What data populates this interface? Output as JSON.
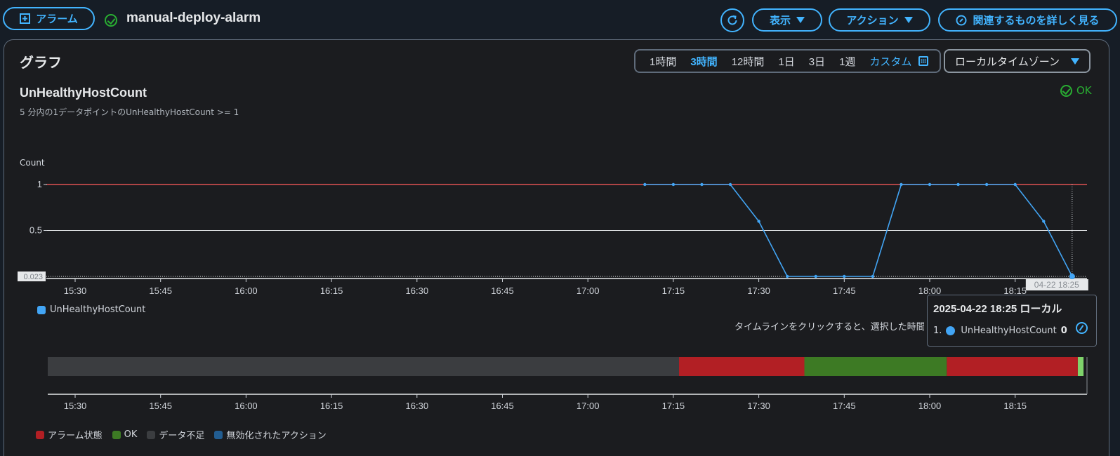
{
  "header": {
    "alarm_button": "アラーム",
    "page_title": "manual-deploy-alarm",
    "view_button": "表示",
    "action_button": "アクション",
    "related_button": "関連するものを詳しく見る"
  },
  "graph": {
    "title": "グラフ",
    "ranges": [
      "1時間",
      "3時間",
      "12時間",
      "1日",
      "3日",
      "1週"
    ],
    "active_range": "3時間",
    "custom_label": "カスタム",
    "timezone": "ローカルタイムゾーン",
    "metric_title": "UnHealthyHostCount",
    "metric_subtitle": "5 分内の1データポイントのUnHealthyHostCount >= 1",
    "status": "OK",
    "y_unit": "Count",
    "hint": "タイムラインをクリックすると、選択した時間",
    "tooltip": {
      "title": "2025-04-22 18:25 ローカル",
      "index": "1.",
      "series": "UnHealthyHostCount",
      "value": "0"
    },
    "legend_series": "UnHealthyHostCount",
    "timeline_legend": [
      {
        "label": "アラーム状態",
        "color": "#b21f24"
      },
      {
        "label": "OK",
        "color": "#3d7a24"
      },
      {
        "label": "データ不足",
        "color": "#3b3d40"
      },
      {
        "label": "無効化されたアクション",
        "color": "#225d91"
      }
    ]
  },
  "chart_data": {
    "type": "line",
    "series": [
      {
        "name": "UnHealthyHostCount",
        "color": "#42a5f5",
        "points": [
          [
            "17:10",
            1
          ],
          [
            "17:15",
            1
          ],
          [
            "17:20",
            1
          ],
          [
            "17:25",
            1
          ],
          [
            "17:30",
            0.6
          ],
          [
            "17:35",
            0
          ],
          [
            "17:40",
            0
          ],
          [
            "17:45",
            0
          ],
          [
            "17:50",
            0
          ],
          [
            "17:55",
            1
          ],
          [
            "18:00",
            1
          ],
          [
            "18:05",
            1
          ],
          [
            "18:10",
            1
          ],
          [
            "18:15",
            1
          ],
          [
            "18:20",
            0.6
          ],
          [
            "18:25",
            0
          ]
        ]
      }
    ],
    "threshold": 1,
    "threshold_color": "#e05252",
    "x_ticks": [
      "15:30",
      "15:45",
      "16:00",
      "16:15",
      "16:30",
      "16:45",
      "17:00",
      "17:15",
      "17:30",
      "17:45",
      "18:00",
      "18:15"
    ],
    "y_ticks": [
      "1",
      "0.5"
    ],
    "y_min_label": "0.023",
    "cursor_label": "04-22 18:25",
    "ylabel": "Count",
    "timeline": [
      {
        "state": "データ不足",
        "from": "15:25",
        "to": "17:16",
        "color": "#3b3d40"
      },
      {
        "state": "アラーム状態",
        "from": "17:16",
        "to": "17:38",
        "color": "#b21f24"
      },
      {
        "state": "OK",
        "from": "17:38",
        "to": "18:03",
        "color": "#3d7a24"
      },
      {
        "state": "アラーム状態",
        "from": "18:03",
        "to": "18:26",
        "color": "#b21f24"
      },
      {
        "state": "OK",
        "from": "18:26",
        "to": "18:27",
        "color": "#7fd36b"
      }
    ]
  }
}
